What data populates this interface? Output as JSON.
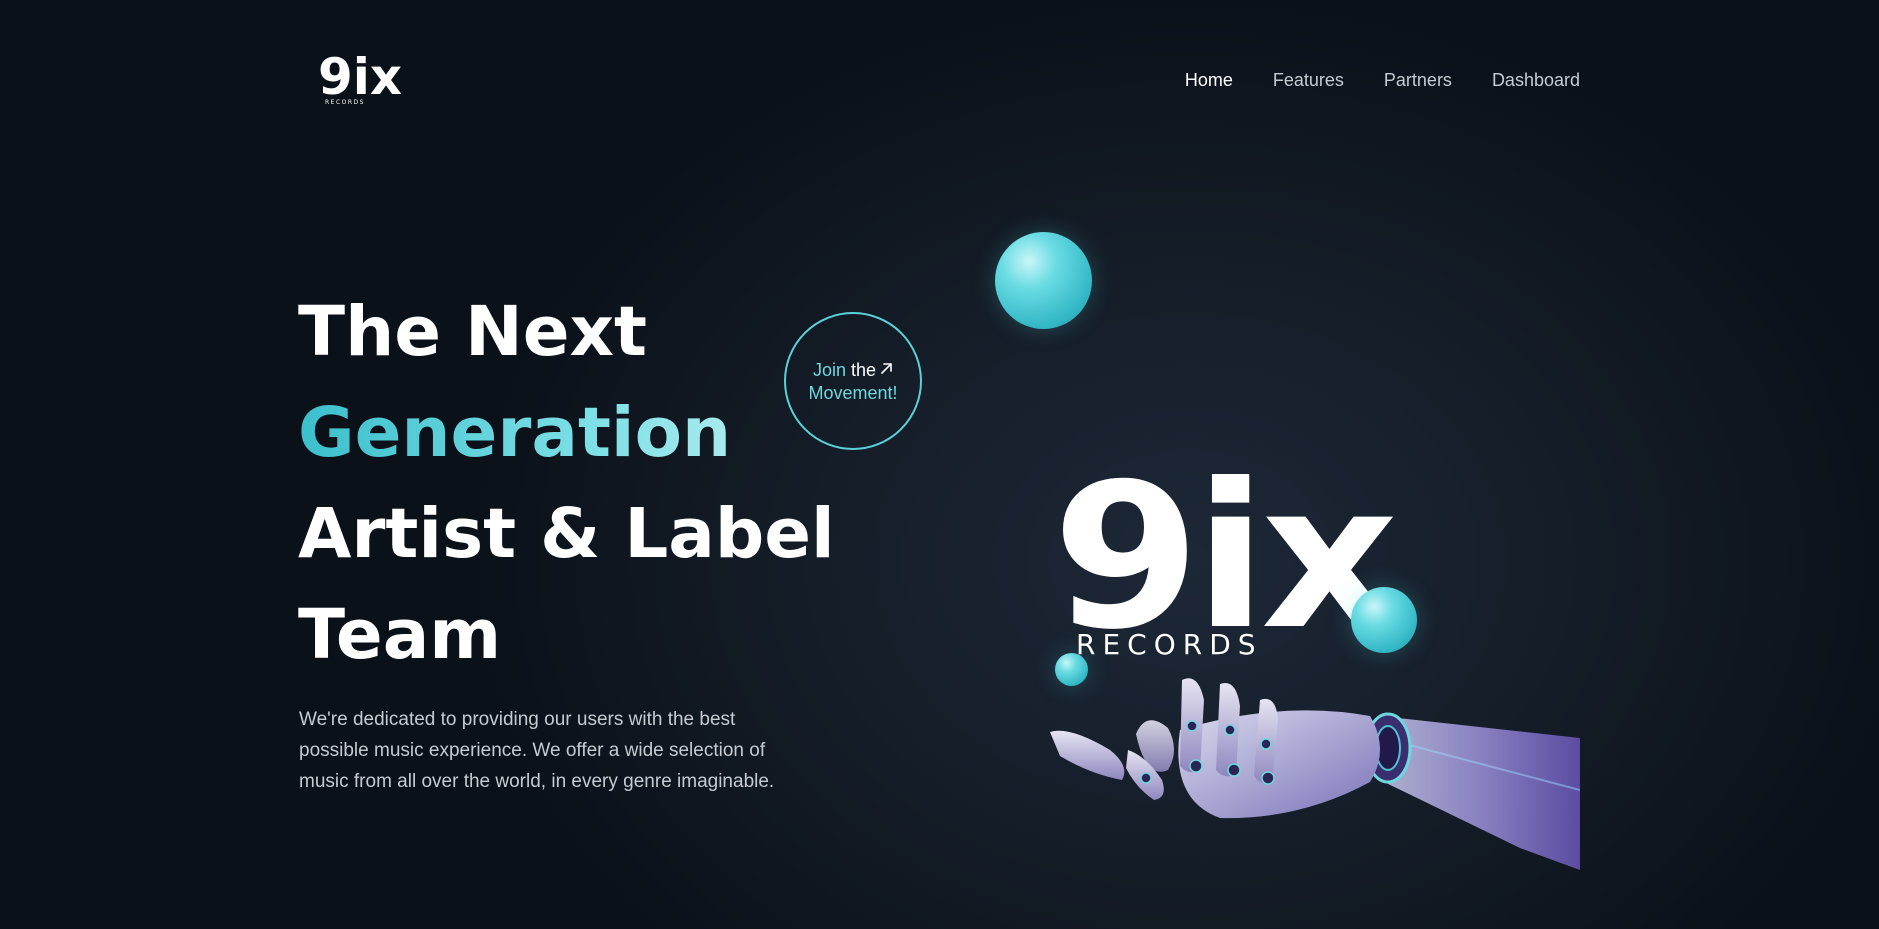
{
  "logo": {
    "mark": "9ix",
    "sub": "RECORDS"
  },
  "nav": {
    "items": [
      "Home",
      "Features",
      "Partners",
      "Dashboard"
    ],
    "active": "Home"
  },
  "hero": {
    "title_line1": "The Next",
    "title_line2": "Generation",
    "title_line3": "Artist & Label",
    "title_line4": "Team",
    "description": "We're dedicated to providing our users with the best possible music experience. We offer a wide selection of music from all over the world, in every genre imaginable.",
    "cta_line1_a": "Join",
    "cta_line1_b": "the",
    "cta_line2": "Movement!"
  },
  "brand_graphic": {
    "mark": "9ix",
    "sub": "RECORDS"
  },
  "icons": {
    "cta_arrow": "arrow-up-right-icon",
    "hand": "robot-hand-icon"
  },
  "colors": {
    "accent": "#5bd0d8",
    "accent_light": "#c8f3f4",
    "background": "#0b1119",
    "text_primary": "#ffffff",
    "text_muted": "#c6cad1"
  }
}
